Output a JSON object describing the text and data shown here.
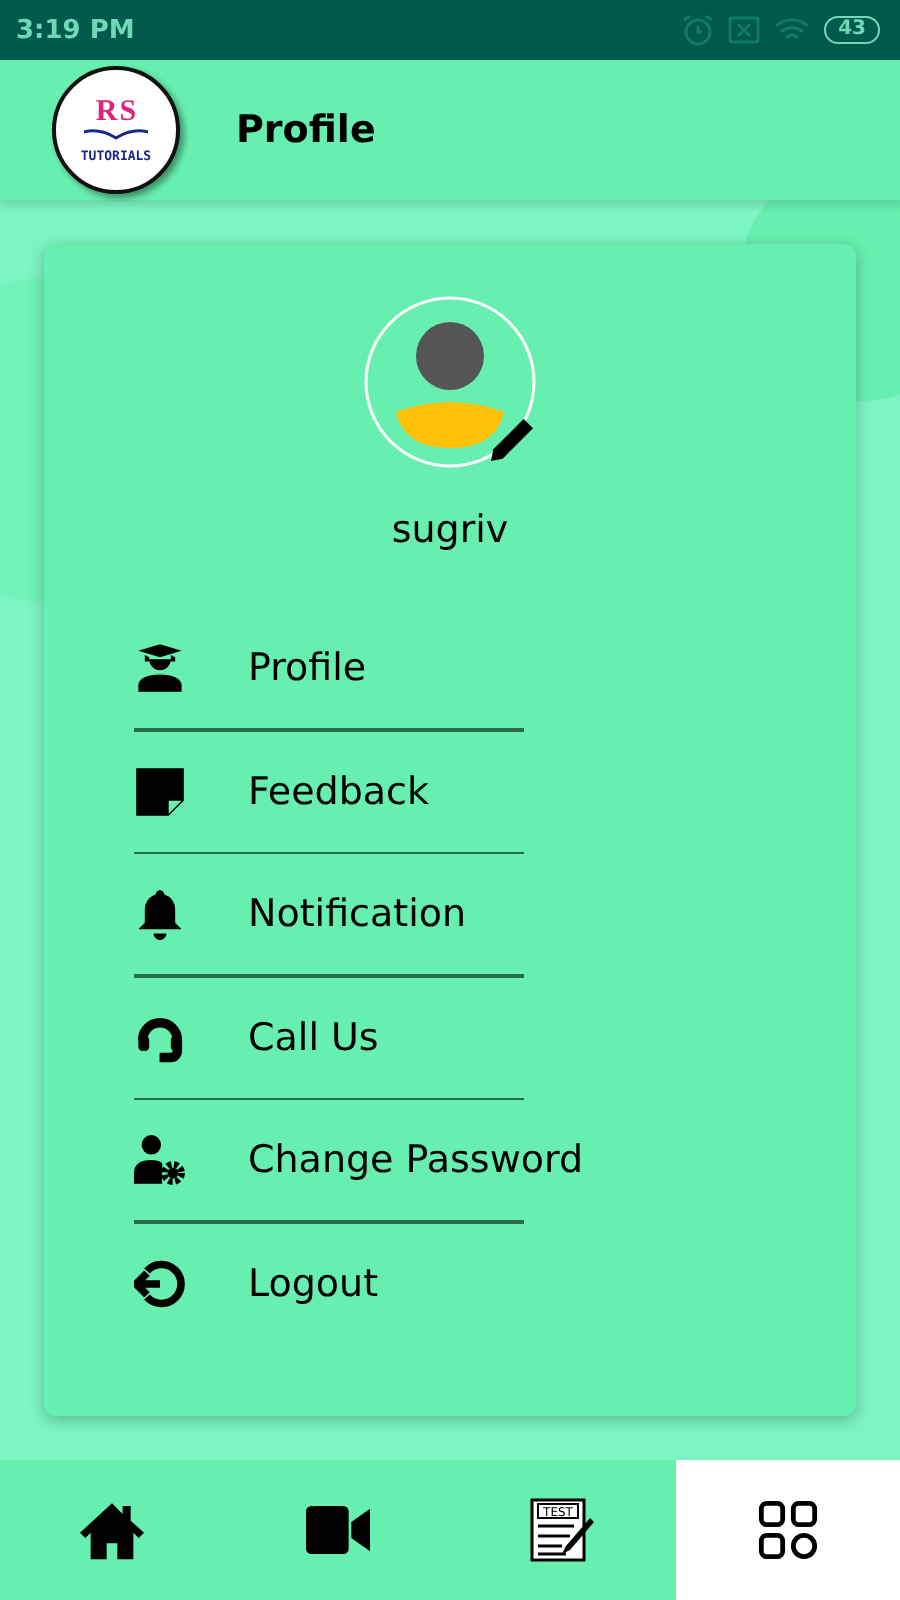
{
  "status_bar": {
    "time": "3:19 PM",
    "battery": "43"
  },
  "header": {
    "logo": {
      "initials_left": "R",
      "initials_right": "S",
      "caption": "TUTORIALS"
    },
    "title": "Profile"
  },
  "profile": {
    "username": "sugriv"
  },
  "menu": [
    {
      "label": "Profile"
    },
    {
      "label": "Feedback"
    },
    {
      "label": "Notification"
    },
    {
      "label": "Call Us"
    },
    {
      "label": "Change Password"
    },
    {
      "label": "Logout"
    }
  ],
  "bottom_nav": [
    {
      "selected": false
    },
    {
      "selected": false
    },
    {
      "badge": "TEST",
      "selected": false
    },
    {
      "selected": true
    }
  ]
}
